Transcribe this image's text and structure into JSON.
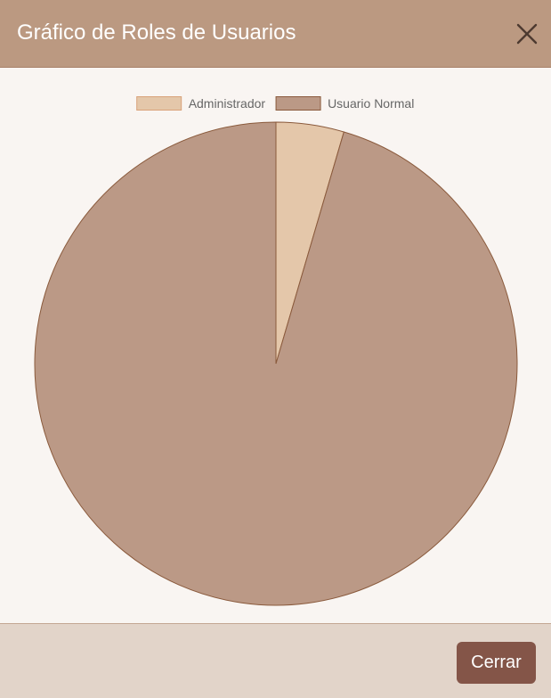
{
  "modal": {
    "title": "Gráfico de Roles de Usuarios",
    "close_icon": "close-icon",
    "footer_button_label": "Cerrar"
  },
  "colors": {
    "header_bg": "#bb9981",
    "body_bg": "#f9f5f2",
    "footer_bg": "#e2d4c9",
    "button_bg": "#845548",
    "slice_border": "#8a5a3c"
  },
  "chart_data": {
    "type": "pie",
    "categories": [
      "Administrador",
      "Usuario Normal"
    ],
    "values": [
      1,
      21
    ],
    "colors": [
      "#e4c7aa",
      "#bb9986"
    ],
    "border_colors": [
      "#d9a27a",
      "#8a5a3c"
    ],
    "legend": "top",
    "start_angle": "top",
    "direction": "clockwise"
  }
}
